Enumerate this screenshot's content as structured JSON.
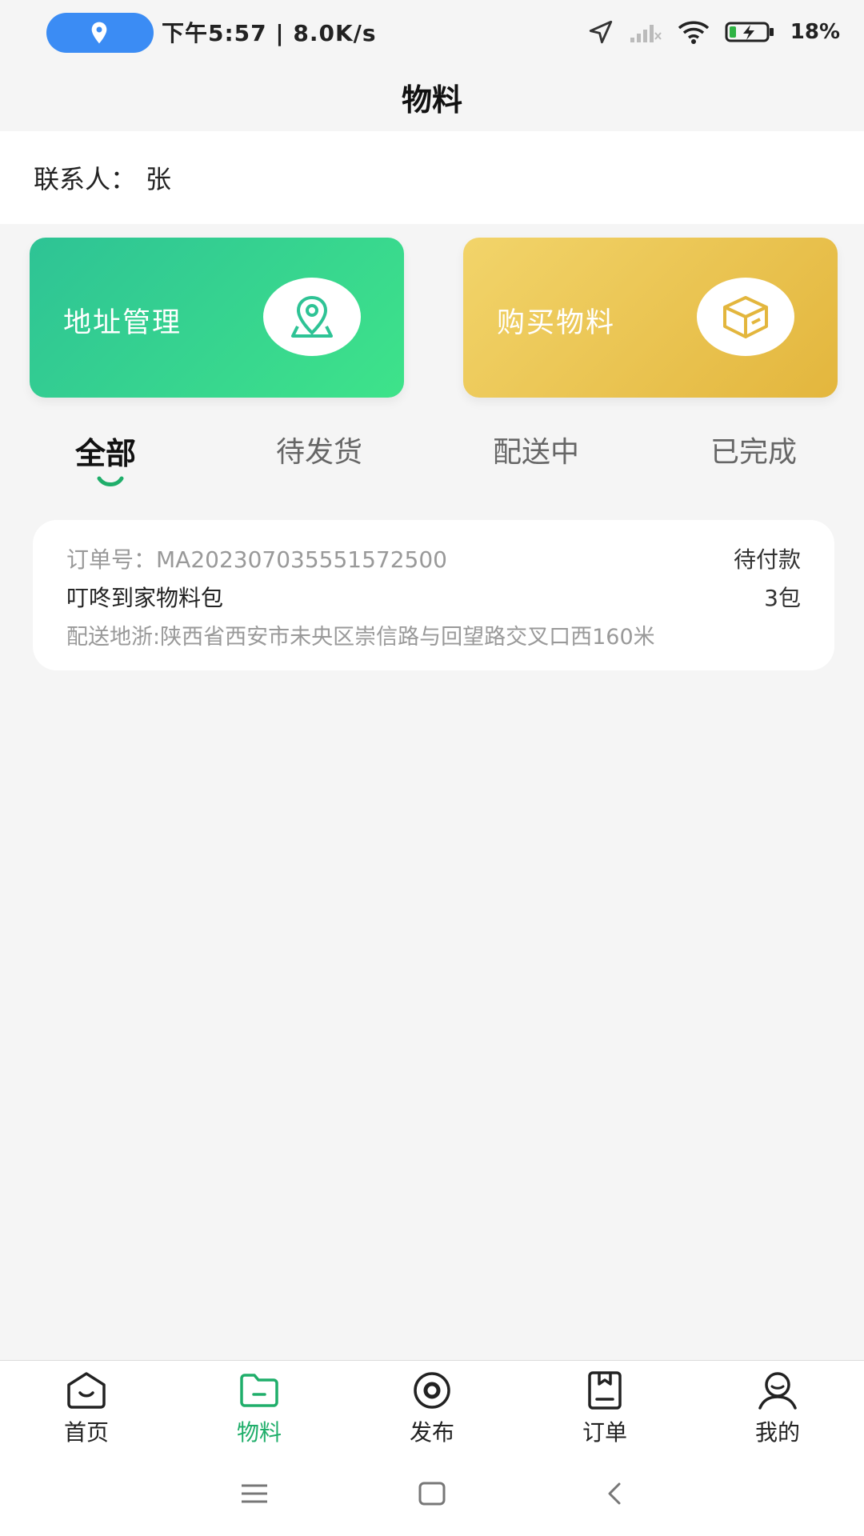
{
  "status_bar": {
    "time_speed": "下午5:57 | 8.0K/s",
    "battery": "18%"
  },
  "page": {
    "title": "物料"
  },
  "contact": {
    "label": "联系人：",
    "name": "张"
  },
  "cards": {
    "address": "地址管理",
    "buy": "购买物料"
  },
  "tabs": [
    "全部",
    "待发货",
    "配送中",
    "已完成"
  ],
  "active_tab": "全部",
  "order": {
    "number_text": "订单号：MA202307035551572500",
    "status": "待付款",
    "name": "叮咚到家物料包",
    "quantity": "3包",
    "address": "配送地浙:陕西省西安市未央区崇信路与回望路交叉口西160米"
  },
  "bottom_nav": [
    {
      "label": "首页",
      "icon": "home-icon"
    },
    {
      "label": "物料",
      "icon": "folder-icon"
    },
    {
      "label": "发布",
      "icon": "publish-icon"
    },
    {
      "label": "订单",
      "icon": "order-icon"
    },
    {
      "label": "我的",
      "icon": "profile-icon"
    }
  ],
  "active_nav": "物料",
  "colors": {
    "brand_green": "#1fae6a",
    "card_green": "#2ec395",
    "card_yellow": "#e3b63d",
    "location_pill": "#3b8cf4"
  }
}
